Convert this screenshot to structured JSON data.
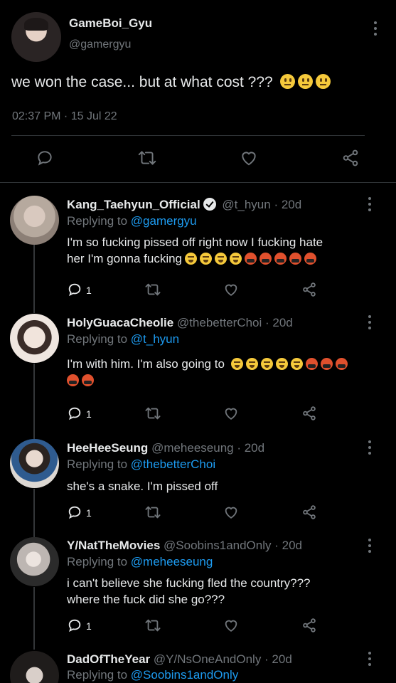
{
  "main_tweet": {
    "display_name": "GameBoi_Gyu",
    "handle": "@gamergyu",
    "text": "we won the case... but at what cost ???",
    "emoji_count": 3,
    "timestamp": "02:37 PM · 15 Jul 22",
    "actions": [
      "reply-icon",
      "retweet-icon",
      "like-icon",
      "share-icon"
    ]
  },
  "replies": [
    {
      "display_name": "Kang_Taehyun_Official",
      "verified": true,
      "meta": "@t_hyun · 20d",
      "replying_label": "Replying to ",
      "replying_to": "@gamergyu",
      "text_line1": "I'm so fucking pissed off right now I fucking hate",
      "text_line2": "her I'm gonna fucking",
      "emojis": [
        "steam",
        "steam",
        "steam",
        "steam",
        "cuss",
        "cuss",
        "cuss",
        "cuss",
        "cuss"
      ],
      "reply_count": "1"
    },
    {
      "display_name": "HolyGuacaCheolie",
      "verified": false,
      "meta": "@thebetterChoi · 20d",
      "replying_label": "Replying to ",
      "replying_to": "@t_hyun",
      "text_line1": "I'm with him. I'm also going to",
      "emojis": [
        "steam",
        "steam",
        "steam",
        "steam",
        "steam",
        "cuss",
        "cuss",
        "cuss",
        "cuss",
        "cuss"
      ],
      "reply_count": "1"
    },
    {
      "display_name": "HeeHeeSeung",
      "verified": false,
      "meta": "@meheeseung · 20d",
      "replying_label": "Replying to ",
      "replying_to": "@thebetterChoi",
      "text_line1": "she's a snake. I'm pissed off",
      "reply_count": "1"
    },
    {
      "display_name": "Y/NatTheMovies",
      "verified": false,
      "meta": "@Soobins1andOnly · 20d",
      "replying_label": "Replying to ",
      "replying_to": "@meheeseung",
      "text_line1": "i can't believe she fucking fled the country???",
      "text_line2": "where the fuck did she go???",
      "reply_count": "1"
    },
    {
      "display_name": "DadOfTheYear",
      "verified": false,
      "meta": "@Y/NsOneAndOnly · 20d",
      "replying_label": "Replying to ",
      "replying_to": "@Soobins1andOnly"
    }
  ],
  "colors": {
    "background": "#000000",
    "text": "#e7e9ea",
    "muted": "#71767b",
    "link": "#1d9bf0",
    "divider": "#2f3336"
  }
}
